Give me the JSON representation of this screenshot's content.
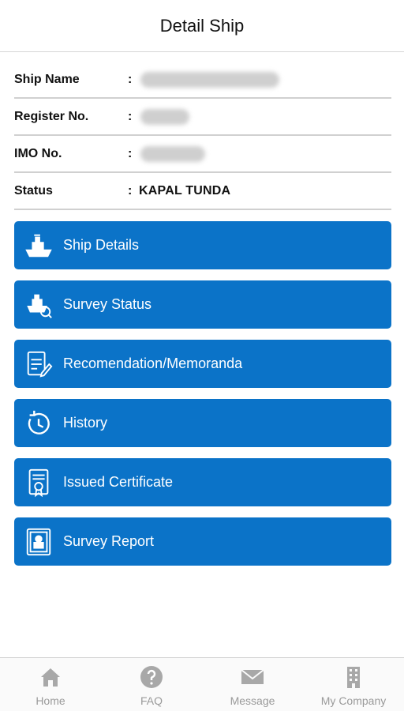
{
  "header": {
    "title": "Detail Ship"
  },
  "info": {
    "rows": [
      {
        "label": "Ship Name",
        "colon": ":",
        "value": ""
      },
      {
        "label": "Register No.",
        "colon": ":",
        "value": ""
      },
      {
        "label": "IMO No.",
        "colon": ":",
        "value": ""
      },
      {
        "label": "Status",
        "colon": ":",
        "value": "KAPAL TUNDA"
      }
    ]
  },
  "menu": {
    "items": [
      {
        "label": "Ship Details",
        "icon": "ship-icon"
      },
      {
        "label": "Survey Status",
        "icon": "survey-ship-icon"
      },
      {
        "label": "Recomendation/Memoranda",
        "icon": "document-edit-icon"
      },
      {
        "label": "History",
        "icon": "history-clock-icon"
      },
      {
        "label": "Issued Certificate",
        "icon": "certificate-icon"
      },
      {
        "label": "Survey Report",
        "icon": "report-icon"
      }
    ]
  },
  "tabbar": {
    "tabs": [
      {
        "label": "Home",
        "icon": "home-icon"
      },
      {
        "label": "FAQ",
        "icon": "question-icon"
      },
      {
        "label": "Message",
        "icon": "envelope-icon"
      },
      {
        "label": "My Company",
        "icon": "building-icon"
      }
    ]
  },
  "colors": {
    "primary": "#0b73c8",
    "tab_inactive": "#9a9a9a"
  }
}
